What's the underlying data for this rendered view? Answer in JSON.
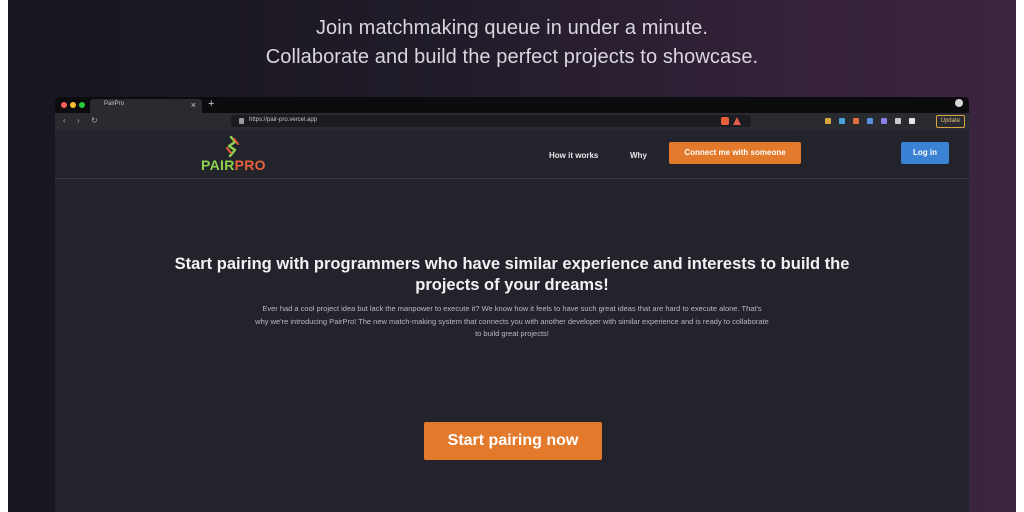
{
  "hero": {
    "tagline_1": "Join matchmaking queue in under a minute.",
    "tagline_2": "Collaborate and build the perfect projects to showcase."
  },
  "browser": {
    "tab_title": "PairPro",
    "tab_close": "×",
    "new_tab": "+",
    "back": "‹",
    "forward": "›",
    "reload": "↻",
    "url": "https://pair-pro.vercel.app",
    "update_label": "Update"
  },
  "site": {
    "logo_pair": "PAIR",
    "logo_pro": "PRO",
    "nav_how": "How it works",
    "nav_why": "Why",
    "connect_label": "Connect me with someone",
    "login_label": "Log in",
    "headline": "Start pairing with programmers who have similar experience and interests to build the projects of your dreams!",
    "blurb": "Ever had a cool project idea but lack the manpower to execute it? We know how it feels to have such great ideas that are hard to execute alone. That's why we're introducing PairPro! The new match-making system that connects you with another developer with similar experience and is ready to collaborate to build great projects!",
    "cta_label": "Start pairing now"
  },
  "colors": {
    "accent_orange": "#e37a2b",
    "login_blue": "#3b82d4",
    "logo_green": "#8fd14f",
    "logo_red": "#e8623c"
  }
}
